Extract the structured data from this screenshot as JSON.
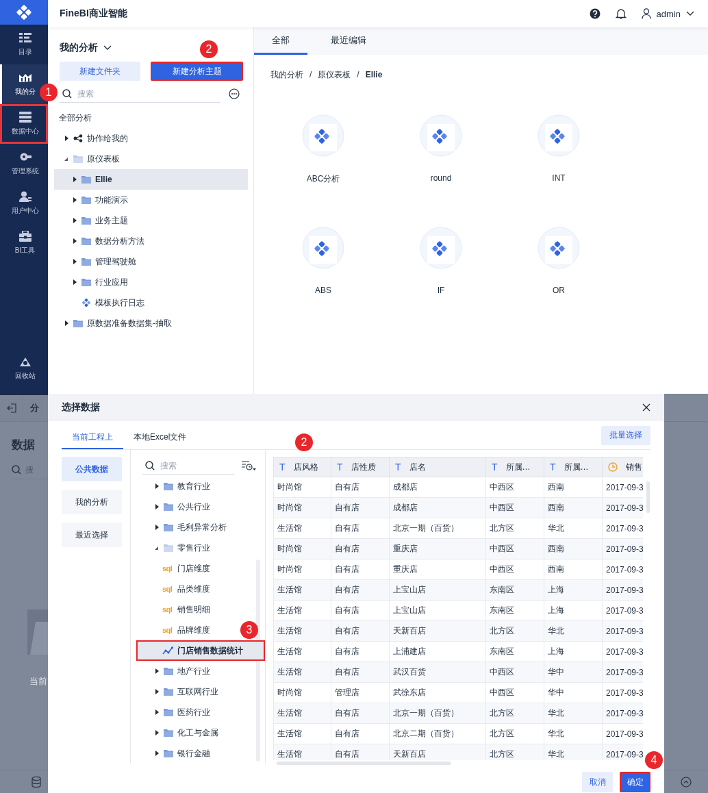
{
  "top": {
    "nav": [
      {
        "label": "目录",
        "selected": false,
        "outlined": false
      },
      {
        "label": "我的分",
        "selected": true,
        "outlined": false
      },
      {
        "label": "数据中心",
        "selected": false,
        "outlined": true,
        "callout": "1"
      },
      {
        "label": "管理系统",
        "selected": false,
        "outlined": false
      },
      {
        "label": "用户中心",
        "selected": false,
        "outlined": false
      },
      {
        "label": "BI工具",
        "selected": false,
        "outlined": false
      }
    ],
    "nav_bottom": {
      "label": "回收站"
    },
    "header": {
      "title": "FineBI商业智能",
      "user": "admin"
    },
    "panel": {
      "title": "我的分析",
      "buttons": [
        {
          "label": "新建文件夹",
          "kind": "secondary",
          "outlined": false
        },
        {
          "label": "新建分析主题",
          "kind": "primary",
          "outlined": true,
          "callout": "2"
        }
      ],
      "search": {
        "placeholder": "搜索"
      },
      "tree_title": "全部分析",
      "tree": [
        {
          "label": "协作给我的",
          "kind": "shared",
          "expanded": false,
          "selected": false
        },
        {
          "label": "原仪表板",
          "kind": "folder",
          "expanded": true,
          "selected": false,
          "children": [
            {
              "label": "Ellie",
              "kind": "folder",
              "expanded": false,
              "selected": true
            },
            {
              "label": "功能演示",
              "kind": "folder",
              "expanded": false,
              "selected": false
            },
            {
              "label": "业务主题",
              "kind": "folder",
              "expanded": false,
              "selected": false
            },
            {
              "label": "数据分析方法",
              "kind": "folder",
              "expanded": false,
              "selected": false
            },
            {
              "label": "管理驾驶舱",
              "kind": "folder",
              "expanded": false,
              "selected": false
            },
            {
              "label": "行业应用",
              "kind": "folder",
              "expanded": false,
              "selected": false
            },
            {
              "label": "模板执行日志",
              "kind": "template",
              "selected": false
            }
          ]
        },
        {
          "label": "原数据准备数据集-抽取",
          "kind": "folder",
          "expanded": false,
          "selected": false
        }
      ]
    },
    "tabs": [
      {
        "label": "全部",
        "selected": true
      },
      {
        "label": "最近编辑",
        "selected": false
      }
    ],
    "breadcrumb": [
      "我的分析",
      "/",
      "原仪表板",
      "/",
      "Ellie"
    ],
    "items": [
      {
        "label": "ABC分析"
      },
      {
        "label": "round"
      },
      {
        "label": "INT"
      },
      {
        "label": "ABS"
      },
      {
        "label": "IF"
      },
      {
        "label": "OR"
      }
    ]
  },
  "bottom": {
    "background": {
      "toolbar_title": "分",
      "heading": "数据",
      "search": {
        "placeholder": "搜"
      },
      "empty_text": "当前"
    },
    "dialog": {
      "title": "选择数据",
      "tabs": [
        {
          "label": "当前工程上",
          "selected": true
        },
        {
          "label": "本地Excel文件",
          "selected": false
        }
      ],
      "batch_button": "批量选择",
      "sources": [
        {
          "label": "公共数据",
          "selected": true
        },
        {
          "label": "我的分析",
          "selected": false
        },
        {
          "label": "最近选择",
          "selected": false
        }
      ],
      "search": {
        "placeholder": "搜索"
      },
      "tree": [
        {
          "label": "教育行业",
          "kind": "folder",
          "expanded": false,
          "selected": false,
          "outlined": false
        },
        {
          "label": "公共行业",
          "kind": "folder",
          "expanded": false,
          "selected": false,
          "outlined": false
        },
        {
          "label": "毛利异常分析",
          "kind": "folder",
          "expanded": false,
          "selected": false,
          "outlined": false
        },
        {
          "label": "零售行业",
          "kind": "folder",
          "expanded": true,
          "selected": false,
          "outlined": false,
          "children": [
            {
              "label": "门店维度",
              "kind": "sql",
              "icon_text": "sql",
              "selected": false,
              "outlined": false
            },
            {
              "label": "品类维度",
              "kind": "sql",
              "icon_text": "sql",
              "selected": false,
              "outlined": false
            },
            {
              "label": "销售明细",
              "kind": "sql",
              "icon_text": "sql",
              "selected": false,
              "outlined": false
            },
            {
              "label": "品牌维度",
              "kind": "sql",
              "icon_text": "sql",
              "selected": false,
              "outlined": false
            },
            {
              "label": "门店销售数据统计",
              "kind": "analysis",
              "selected": true,
              "outlined": true,
              "callout": "3"
            }
          ]
        },
        {
          "label": "地产行业",
          "kind": "folder",
          "expanded": false,
          "selected": false,
          "outlined": false
        },
        {
          "label": "互联网行业",
          "kind": "folder",
          "expanded": false,
          "selected": false,
          "outlined": false
        },
        {
          "label": "医药行业",
          "kind": "folder",
          "expanded": false,
          "selected": false,
          "outlined": false
        },
        {
          "label": "化工与金属",
          "kind": "folder",
          "expanded": false,
          "selected": false,
          "outlined": false
        },
        {
          "label": "银行金融",
          "kind": "folder",
          "expanded": false,
          "selected": false,
          "outlined": false
        }
      ],
      "table": {
        "callout": "2",
        "columns": [
          {
            "label": "店风格",
            "kind": "text",
            "type_mark": "T"
          },
          {
            "label": "店性质",
            "kind": "text",
            "type_mark": "T"
          },
          {
            "label": "店名",
            "kind": "text",
            "type_mark": "T"
          },
          {
            "label": "所属…",
            "kind": "text",
            "type_mark": "T"
          },
          {
            "label": "所属…",
            "kind": "text",
            "type_mark": "T"
          },
          {
            "label": "销售",
            "kind": "date"
          }
        ],
        "rows": [
          [
            "时尚馆",
            "自有店",
            "成都店",
            "中西区",
            "西南",
            "2017-09-3"
          ],
          [
            "时尚馆",
            "自有店",
            "成都店",
            "中西区",
            "西南",
            "2017-09-3"
          ],
          [
            "生活馆",
            "自有店",
            "北京一期（百货）",
            "北方区",
            "华北",
            "2017-09-3"
          ],
          [
            "时尚馆",
            "自有店",
            "重庆店",
            "中西区",
            "西南",
            "2017-09-3"
          ],
          [
            "时尚馆",
            "自有店",
            "重庆店",
            "中西区",
            "西南",
            "2017-09-3"
          ],
          [
            "生活馆",
            "自有店",
            "上宝山店",
            "东南区",
            "上海",
            "2017-09-3"
          ],
          [
            "生活馆",
            "自有店",
            "上宝山店",
            "东南区",
            "上海",
            "2017-09-3"
          ],
          [
            "生活馆",
            "自有店",
            "天新百店",
            "北方区",
            "华北",
            "2017-09-3"
          ],
          [
            "生活馆",
            "自有店",
            "上浦建店",
            "东南区",
            "上海",
            "2017-09-3"
          ],
          [
            "生活馆",
            "自有店",
            "武汉百货",
            "中西区",
            "华中",
            "2017-09-3"
          ],
          [
            "时尚馆",
            "管理店",
            "武徐东店",
            "中西区",
            "华中",
            "2017-09-3"
          ],
          [
            "生活馆",
            "自有店",
            "北京一期（百货）",
            "北方区",
            "华北",
            "2017-09-3"
          ],
          [
            "生活馆",
            "自有店",
            "北京二期（百货）",
            "北方区",
            "华北",
            "2017-09-3"
          ],
          [
            "生活馆",
            "自有店",
            "天新百店",
            "北方区",
            "华北",
            "2017-09-3"
          ]
        ]
      },
      "buttons": [
        {
          "label": "取消",
          "kind": "secondary",
          "outlined": false
        },
        {
          "label": "确定",
          "kind": "primary",
          "outlined": true,
          "callout": "4"
        }
      ]
    }
  }
}
